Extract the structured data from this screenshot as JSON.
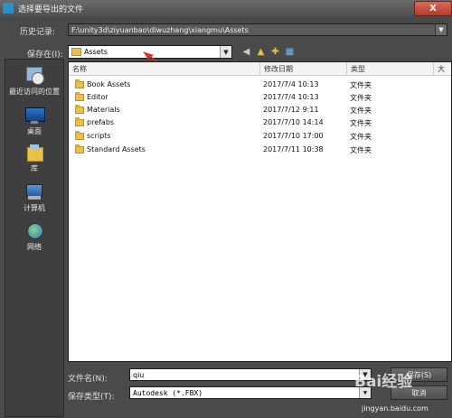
{
  "window": {
    "title": "选择要导出的文件",
    "close_label": "X"
  },
  "history": {
    "label": "历史记录:",
    "value": "F:\\unity3d\\ziyuanbao\\diwuzhang\\xiangmu\\Assets"
  },
  "save_in": {
    "label": "保存在(I):",
    "value": "Assets"
  },
  "sidebar": {
    "items": [
      {
        "label": "最近访问的位置",
        "icon": "recent-places-icon"
      },
      {
        "label": "桌面",
        "icon": "desktop-icon"
      },
      {
        "label": "库",
        "icon": "library-icon"
      },
      {
        "label": "计算机",
        "icon": "computer-icon"
      },
      {
        "label": "网络",
        "icon": "network-icon"
      }
    ]
  },
  "columns": {
    "name": "名称",
    "modified": "修改日期",
    "type": "类型",
    "size": "大"
  },
  "files": [
    {
      "name": "Book Assets",
      "modified": "2017/7/4 10:13",
      "type": "文件夹"
    },
    {
      "name": "Editor",
      "modified": "2017/7/4 10:13",
      "type": "文件夹"
    },
    {
      "name": "Materials",
      "modified": "2017/7/12 9:11",
      "type": "文件夹"
    },
    {
      "name": "prefabs",
      "modified": "2017/7/10 14:14",
      "type": "文件夹"
    },
    {
      "name": "scripts",
      "modified": "2017/7/10 17:00",
      "type": "文件夹"
    },
    {
      "name": "Standard Assets",
      "modified": "2017/7/11 10:38",
      "type": "文件夹"
    }
  ],
  "filename": {
    "label": "文件名(N):",
    "value": "qiu"
  },
  "filetype": {
    "label": "保存类型(T):",
    "value": "Autodesk (*.FBX)"
  },
  "buttons": {
    "save": "保存(S)",
    "cancel": "取消"
  },
  "watermark": {
    "text": "Bai经验",
    "url": "jingyan.baidu.com"
  },
  "colors": {
    "background": "#4a4a4a",
    "list_background": "#ffffff",
    "folder": "#e9c14f",
    "annotation_arrow": "#d83030"
  }
}
